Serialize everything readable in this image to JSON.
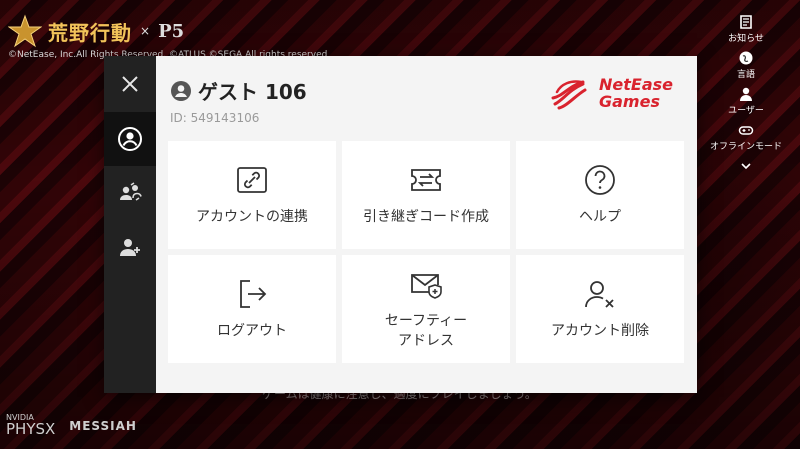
{
  "background": {
    "game_title": "荒野行動",
    "collab_logo": "P5",
    "copyright": "©NetEase, Inc.All Rights Reserved. ©ATLUS ©SEGA All rights reserved",
    "caption": "ゲームは健康に注意し、適度にプレイしましょう。",
    "physx_top": "NVIDIA",
    "physx_bottom": "PHYSX",
    "messiah": "MESSIAH"
  },
  "right_menu": [
    {
      "label": "お知らせ",
      "icon": "news-icon"
    },
    {
      "label": "言語",
      "icon": "globe-icon"
    },
    {
      "label": "ユーザー",
      "icon": "user-icon"
    },
    {
      "label": "オフラインモード",
      "icon": "gamepad-icon"
    }
  ],
  "dialog": {
    "user_name": "ゲスト 106",
    "user_id": "ID: 549143106",
    "brand_line1": "NetEase",
    "brand_line2": "Games",
    "tiles": [
      {
        "label": "アカウントの連携",
        "icon": "link-icon"
      },
      {
        "label": "引き継ぎコード作成",
        "icon": "transfer-ticket-icon"
      },
      {
        "label": "ヘルプ",
        "icon": "help-icon"
      },
      {
        "label": "ログアウト",
        "icon": "logout-icon"
      },
      {
        "label": "セーフティー\nアドレス",
        "icon": "safety-mail-icon"
      },
      {
        "label": "アカウント削除",
        "icon": "delete-account-icon"
      }
    ]
  },
  "colors": {
    "brand_red": "#d9232e",
    "sidebar": "#222222",
    "panel": "#f4f4f4"
  }
}
